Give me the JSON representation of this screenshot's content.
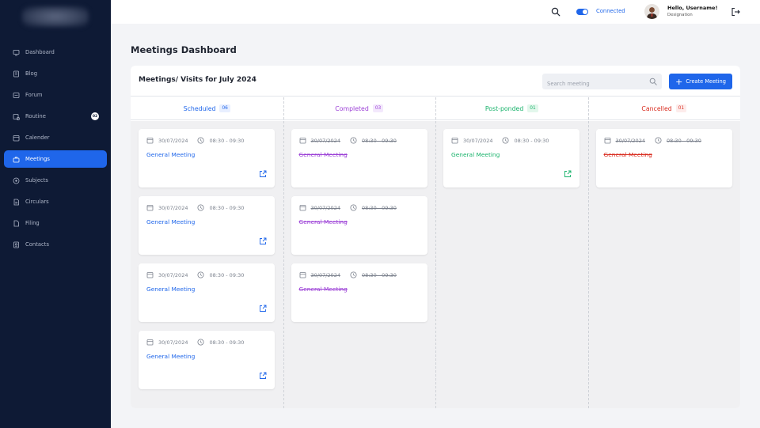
{
  "sidebar": {
    "items": [
      {
        "label": "Dashboard",
        "icon": "monitor-icon",
        "active": false
      },
      {
        "label": "Blog",
        "icon": "blog-icon",
        "active": false
      },
      {
        "label": "Forum",
        "icon": "forum-icon",
        "active": false
      },
      {
        "label": "Routine",
        "icon": "routine-icon",
        "active": false,
        "badge": "02"
      },
      {
        "label": "Calender",
        "icon": "calendar-icon",
        "active": false
      },
      {
        "label": "Meetings",
        "icon": "briefcase-icon",
        "active": true
      },
      {
        "label": "Subjects",
        "icon": "subjects-icon",
        "active": false
      },
      {
        "label": "Circulars",
        "icon": "document-icon",
        "active": false
      },
      {
        "label": "Filing",
        "icon": "file-icon",
        "active": false
      },
      {
        "label": "Contacts",
        "icon": "contacts-icon",
        "active": false
      }
    ]
  },
  "topbar": {
    "status": "Connected",
    "greeting": "Hello, Username!",
    "designation": "Designation"
  },
  "page": {
    "title": "Meetings Dashboard",
    "board_title": "Meetings/ Visits for July 2024",
    "search_placeholder": "Search meeting",
    "create_label": "Create Meeting"
  },
  "colors": {
    "accent": "#1f66ea",
    "scheduled": "#1f66ea",
    "completed": "#9b3fd6",
    "postponed": "#17b26a",
    "cancelled": "#d92d20"
  },
  "columns": [
    {
      "title": "Scheduled",
      "count": "06",
      "color": "#1f66ea",
      "badge_bg": "#e8efff",
      "strike": false,
      "cards": [
        {
          "date": "30/07/2024",
          "time": "08:30 - 09:30",
          "title": "General Meeting",
          "link": true
        },
        {
          "date": "30/07/2024",
          "time": "08:30 - 09:30",
          "title": "General Meeting",
          "link": true
        },
        {
          "date": "30/07/2024",
          "time": "08:30 - 09:30",
          "title": "General Meeting",
          "link": true
        },
        {
          "date": "30/07/2024",
          "time": "08:30 - 09:30",
          "title": "General Meeting",
          "link": true
        }
      ]
    },
    {
      "title": "Completed",
      "count": "03",
      "color": "#9b3fd6",
      "badge_bg": "#f3e8fc",
      "strike": true,
      "cards": [
        {
          "date": "30/07/2024",
          "time": "08:30 - 09:30",
          "title": "General Meeting",
          "link": false
        },
        {
          "date": "30/07/2024",
          "time": "08:30 - 09:30",
          "title": "General Meeting",
          "link": false
        },
        {
          "date": "30/07/2024",
          "time": "08:30 - 09:30",
          "title": "General Meeting",
          "link": false
        }
      ]
    },
    {
      "title": "Post-ponded",
      "count": "01",
      "color": "#17b26a",
      "badge_bg": "#e3f7ec",
      "strike": false,
      "cards": [
        {
          "date": "30/07/2024",
          "time": "08:30 - 09:30",
          "title": "General Meeting",
          "link": true
        }
      ]
    },
    {
      "title": "Cancelled",
      "count": "01",
      "color": "#d92d20",
      "badge_bg": "#fdeceb",
      "strike": true,
      "cards": [
        {
          "date": "30/07/2024",
          "time": "08:30 - 09:30",
          "title": "General Meeting",
          "link": false
        }
      ]
    }
  ]
}
